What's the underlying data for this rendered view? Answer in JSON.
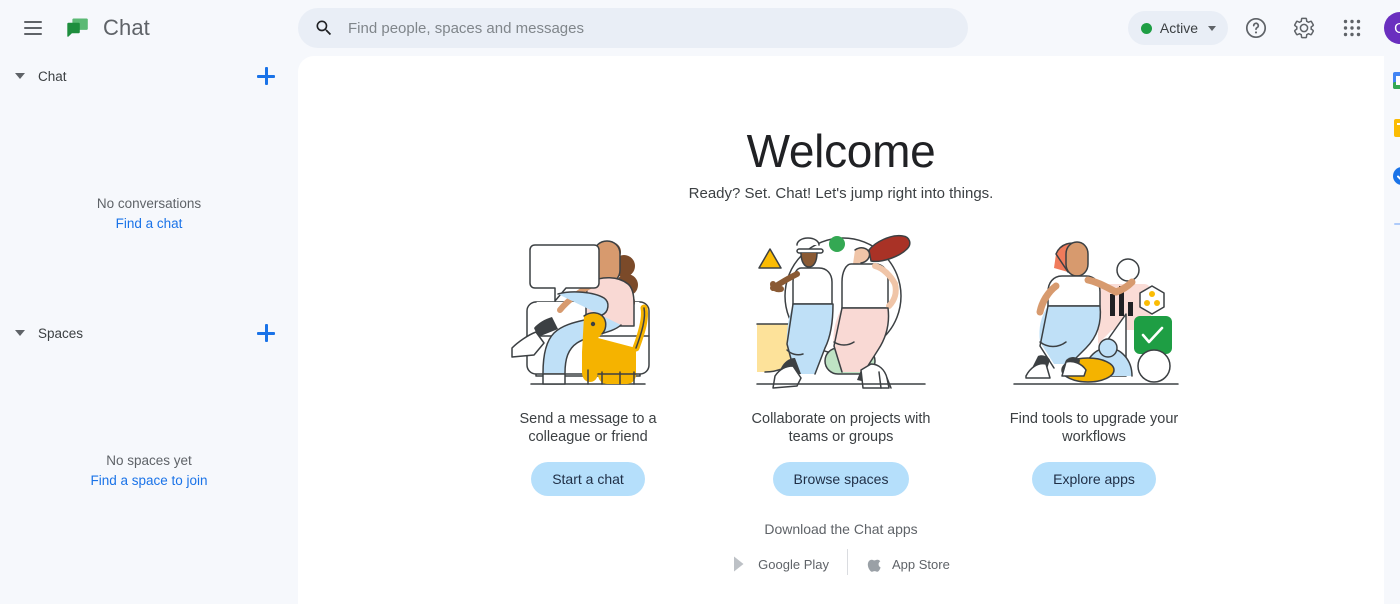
{
  "header": {
    "menu_icon": "hamburger-menu-icon",
    "logo_icon": "google-chat-logo",
    "title": "Chat",
    "search": {
      "icon": "search-icon",
      "placeholder": "Find people, spaces and messages",
      "value": ""
    },
    "status": {
      "label": "Active",
      "dot_color": "#1e9e44",
      "caret_icon": "chevron-down-icon"
    },
    "actions": [
      {
        "name": "help-icon",
        "label": "Support"
      },
      {
        "name": "gear-icon",
        "label": "Settings"
      },
      {
        "name": "apps-grid-icon",
        "label": "Google apps"
      }
    ],
    "avatar": {
      "initial": "G",
      "color": "#6a2fbf"
    }
  },
  "sidebar": {
    "sections": [
      {
        "title": "Chat",
        "add_label": "+",
        "empty_title": "No conversations",
        "empty_link": "Find a chat"
      },
      {
        "title": "Spaces",
        "add_label": "+",
        "empty_title": "No spaces yet",
        "empty_link": "Find a space to join"
      }
    ]
  },
  "main": {
    "welcome_title": "Welcome",
    "welcome_subtitle": "Ready? Set. Chat! Let's jump right into things.",
    "cards": [
      {
        "illustration": "person-in-armchair-with-dog-illustration",
        "text": "Send a message to a colleague or friend",
        "button": "Start a chat"
      },
      {
        "illustration": "two-people-collaborating-illustration",
        "text": "Collaborate on projects with teams or groups",
        "button": "Browse spaces"
      },
      {
        "illustration": "person-with-app-tools-illustration",
        "text": "Find tools to upgrade your workflows",
        "button": "Explore apps"
      }
    ],
    "download_label": "Download the Chat apps",
    "badges": [
      {
        "icon": "google-play-icon",
        "label": "Google Play"
      },
      {
        "icon": "apple-icon",
        "label": "App Store"
      }
    ]
  },
  "side_panel": {
    "items": [
      {
        "name": "google-calendar-icon",
        "label": "Calendar"
      },
      {
        "name": "google-keep-icon",
        "label": "Keep"
      },
      {
        "name": "google-tasks-icon",
        "label": "Tasks"
      },
      {
        "name": "add-apps-icon",
        "label": "Get add-ons"
      }
    ]
  },
  "theme": {
    "surface": "#f6f8fc",
    "panel": "#ffffff",
    "accent_blue": "#1a73e8",
    "button_blue": "#b5dffb",
    "search_bg": "#e9eef6"
  }
}
